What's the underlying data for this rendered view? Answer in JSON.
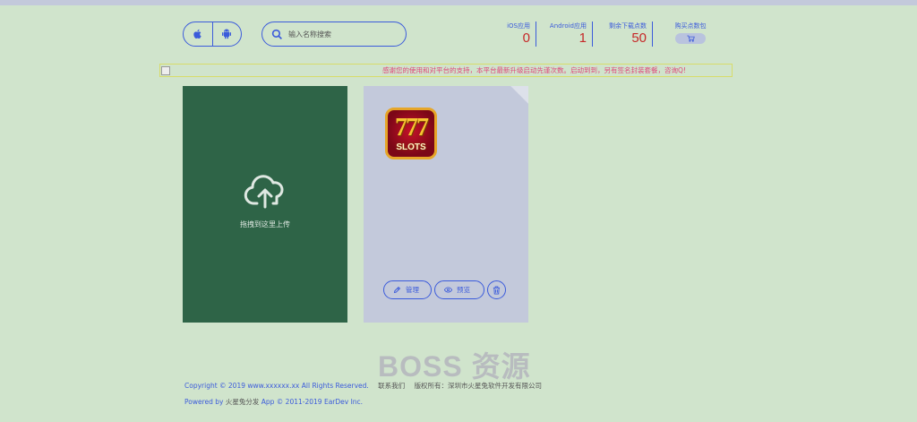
{
  "header": {
    "search_placeholder": "输入名称搜索",
    "stats": {
      "ios": {
        "label": "iOS应用",
        "value": "0"
      },
      "android": {
        "label": "Android应用",
        "value": "1"
      },
      "downloads": {
        "label": "剩余下载点数",
        "value": "50"
      },
      "buy": {
        "label": "购买点数包"
      }
    }
  },
  "notice": {
    "text": "感谢您的使用和对平台的支持，本平台最新升级启动先谨次数。启动到到，另有签名封装套餐，咨询Q!"
  },
  "upload": {
    "label": "拖拽到这里上传"
  },
  "app_card": {
    "icon_text_top": "777",
    "icon_text_bottom": "SLOTS",
    "manage_label": "管理",
    "preview_label": "预览"
  },
  "watermark": "BOSS 资源",
  "footer": {
    "copyright": "Copyright © 2019 www.xxxxxx.xx All Rights Reserved.",
    "contact": "联系我们",
    "rights": "版权所有：深圳市火星兔软件开发有限公司",
    "powered_prefix": "Powered by",
    "powered_name": "火星兔分发",
    "powered_suffix": "App © 2011-2019 EarDev Inc."
  },
  "colors": {
    "background": "#d0e4cc",
    "accent": "#3b5bdb",
    "stat_value": "#c62828",
    "upload_card": "#2e6447",
    "app_card": "#c3c9db",
    "notice_text": "#e0457b"
  }
}
